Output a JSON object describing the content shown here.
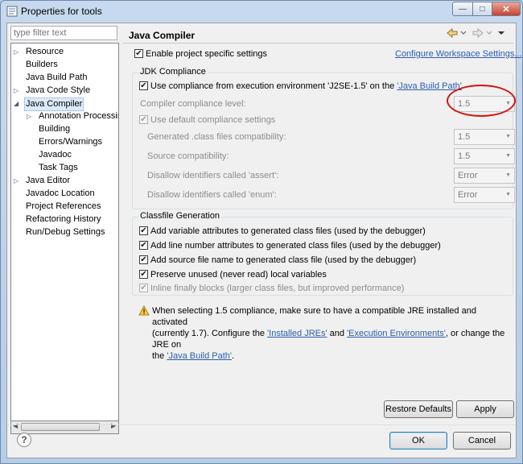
{
  "window": {
    "title": "Properties for tools",
    "min_glyph": "—",
    "max_glyph": "□",
    "close_glyph": "✕"
  },
  "sidebar": {
    "filter_placeholder": "type filter text",
    "items": [
      {
        "label": "Resource",
        "expandable": true
      },
      {
        "label": "Builders",
        "expandable": false
      },
      {
        "label": "Java Build Path",
        "expandable": false
      },
      {
        "label": "Java Code Style",
        "expandable": true
      },
      {
        "label": "Java Compiler",
        "expandable": true,
        "expanded": true,
        "selected": true
      },
      {
        "label": "Annotation Processin",
        "expandable": true,
        "child": true
      },
      {
        "label": "Building",
        "child": true
      },
      {
        "label": "Errors/Warnings",
        "child": true
      },
      {
        "label": "Javadoc",
        "child": true
      },
      {
        "label": "Task Tags",
        "child": true
      },
      {
        "label": "Java Editor",
        "expandable": true
      },
      {
        "label": "Javadoc Location",
        "expandable": false
      },
      {
        "label": "Project References",
        "expandable": false
      },
      {
        "label": "Refactoring History",
        "expandable": false
      },
      {
        "label": "Run/Debug Settings",
        "expandable": false
      }
    ]
  },
  "page": {
    "title": "Java Compiler",
    "enable_specific": "Enable project specific settings",
    "configure_workspace": "Configure Workspace Settings...",
    "jdk": {
      "group_title": "JDK Compliance",
      "use_compliance_prefix": "Use compliance from execution environment 'J2SE-1.5' on the ",
      "use_compliance_link": "'Java Build Path'",
      "compliance_level_label": "Compiler compliance level:",
      "compliance_level_value": "1.5",
      "use_default": "Use default compliance settings",
      "generated_label": "Generated .class files compatibility:",
      "generated_value": "1.5",
      "source_label": "Source compatibility:",
      "source_value": "1.5",
      "assert_label": "Disallow identifiers called 'assert':",
      "assert_value": "Error",
      "enum_label": "Disallow identifiers called 'enum':",
      "enum_value": "Error"
    },
    "classfile": {
      "group_title": "Classfile Generation",
      "options": [
        "Add variable attributes to generated class files (used by the debugger)",
        "Add line number attributes to generated class files (used by the debugger)",
        "Add source file name to generated class file (used by the debugger)",
        "Preserve unused (never read) local variables",
        "Inline finally blocks (larger class files, but improved performance)"
      ]
    },
    "note": {
      "line1": "When selecting 1.5 compliance, make sure to have a compatible JRE installed and activated",
      "line2_a": "(currently 1.7). Configure the ",
      "link_installed": "'Installed JREs'",
      "and": " and ",
      "link_exec": "'Execution Environments'",
      "line2_b": ", or change the JRE on",
      "line3_a": "the ",
      "link_build": "'Java Build Path'",
      "line3_b": "."
    },
    "restore_defaults": "Restore Defaults",
    "apply": "Apply"
  },
  "footer": {
    "help": "?",
    "ok": "OK",
    "cancel": "Cancel"
  },
  "colors": {
    "link": "#2a5db0",
    "annotation": "#d41414"
  }
}
